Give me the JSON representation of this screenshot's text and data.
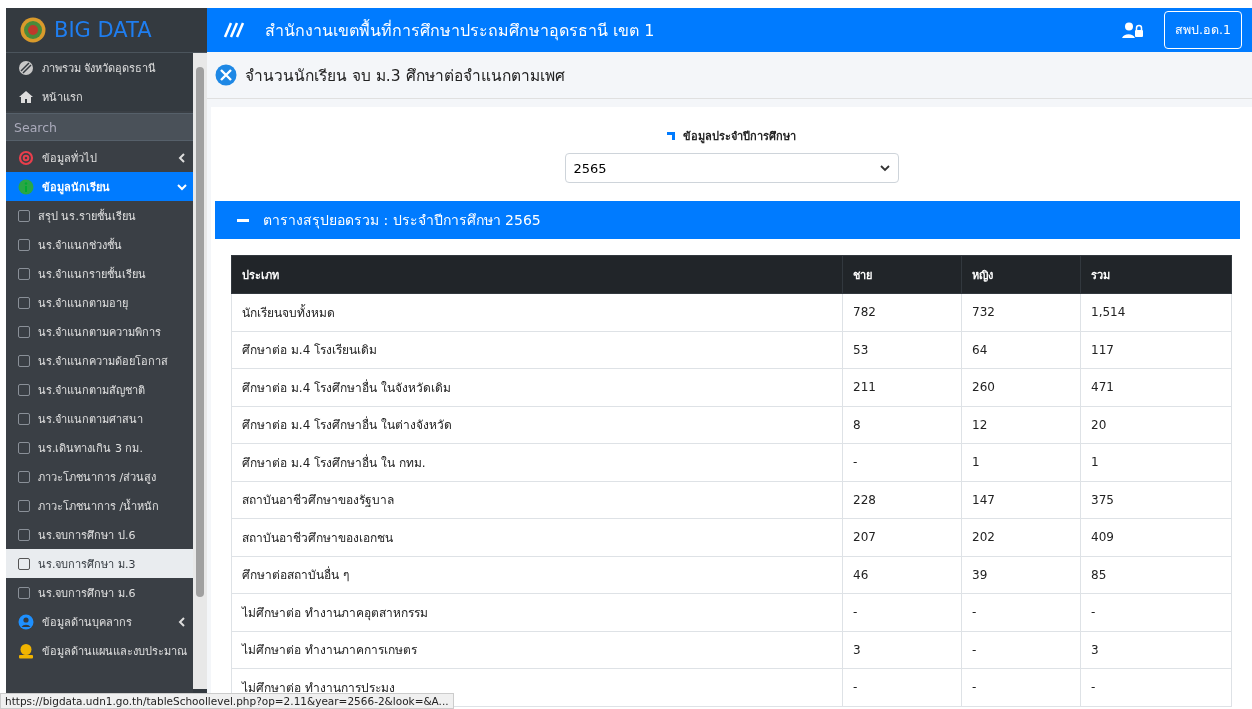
{
  "sidebar": {
    "brand": "BIG DATA",
    "top_items": [
      {
        "kind": "globe",
        "label": "ภาพรวม จังหวัดอุดรธานี"
      },
      {
        "kind": "home",
        "label": "หน้าแรก"
      }
    ],
    "search": {
      "placeholder": "Search"
    },
    "menu": [
      {
        "kind": "at",
        "label": "ข้อมูลทั่วไป",
        "selected": false,
        "expanded": false
      },
      {
        "kind": "info",
        "label": "ข้อมูลนักเรียน",
        "selected": true,
        "expanded": true,
        "children": [
          {
            "label": "สรุป นร.รายชั้นเรียน",
            "selected": false
          },
          {
            "label": "นร.จำแนกช่วงชั้น",
            "selected": false
          },
          {
            "label": "นร.จำแนกรายชั้นเรียน",
            "selected": false
          },
          {
            "label": "นร.จำแนกตามอายุ",
            "selected": false
          },
          {
            "label": "นร.จำแนกตามความพิการ",
            "selected": false
          },
          {
            "label": "นร.จำแนกความด้อยโอกาส",
            "selected": false
          },
          {
            "label": "นร.จำแนกตามสัญชาติ",
            "selected": false
          },
          {
            "label": "นร.จำแนกตามศาสนา",
            "selected": false
          },
          {
            "label": "นร.เดินทางเกิน 3 กม.",
            "selected": false
          },
          {
            "label": "ภาวะโภชนาการ /ส่วนสูง",
            "selected": false
          },
          {
            "label": "ภาวะโภชนาการ /น้ำหนัก",
            "selected": false
          },
          {
            "label": "นร.จบการศึกษา ป.6",
            "selected": false
          },
          {
            "label": "นร.จบการศึกษา ม.3",
            "selected": true
          },
          {
            "label": "นร.จบการศึกษา ม.6",
            "selected": false
          }
        ]
      },
      {
        "kind": "user",
        "label": "ข้อมูลด้านบุคลากร",
        "selected": false,
        "expanded": false
      },
      {
        "kind": "money",
        "label": "ข้อมูลด้านแผนและงบประมาณ",
        "selected": false
      }
    ]
  },
  "topbar": {
    "title": "สำนักงานเขตพื้นที่การศึกษาประถมศึกษาอุดรธานี เขต 1",
    "user_button": "สพป.อด.1"
  },
  "page_title": "จำนวนนักเรียน จบ ม.3 ศึกษาต่อจำแนกตามเพศ",
  "filter": {
    "label": "ข้อมูลประจำปีการศึกษา",
    "value": "2565"
  },
  "card": {
    "title": "ตารางสรุปยอดรวม : ประจำปีการศึกษา 2565",
    "table": {
      "columns": [
        "ประเภท",
        "ชาย",
        "หญิง",
        "รวม"
      ],
      "rows": [
        [
          "นักเรียนจบทั้งหมด",
          "782",
          "732",
          "1,514"
        ],
        [
          "ศึกษาต่อ ม.4 โรงเรียนเดิม",
          "53",
          "64",
          "117"
        ],
        [
          "ศึกษาต่อ ม.4 โรงศึกษาอื่น ในจังหวัดเดิม",
          "211",
          "260",
          "471"
        ],
        [
          "ศึกษาต่อ ม.4 โรงศึกษาอื่น ในต่างจังหวัด",
          "8",
          "12",
          "20"
        ],
        [
          "ศึกษาต่อ ม.4 โรงศึกษาอื่น ใน กทม.",
          "-",
          "1",
          "1"
        ],
        [
          "สถาบันอาชีวศึกษาของรัฐบาล",
          "228",
          "147",
          "375"
        ],
        [
          "สถาบันอาชีวศึกษาของเอกชน",
          "207",
          "202",
          "409"
        ],
        [
          "ศึกษาต่อสถาบันอื่น ๆ",
          "46",
          "39",
          "85"
        ],
        [
          "ไม่ศึกษาต่อ ทำงานภาคอุตสาหกรรม",
          "-",
          "-",
          "-"
        ],
        [
          "ไม่ศึกษาต่อ ทำงานภาคการเกษตร",
          "3",
          "-",
          "3"
        ],
        [
          "ไม่ศึกษาต่อ ทำงานการประมง",
          "-",
          "-",
          "-"
        ]
      ]
    }
  },
  "status_url": "https://bigdata.udn1.go.th/tableSchoollevel.php?op=2.11&year=2566-2&look=&A..."
}
